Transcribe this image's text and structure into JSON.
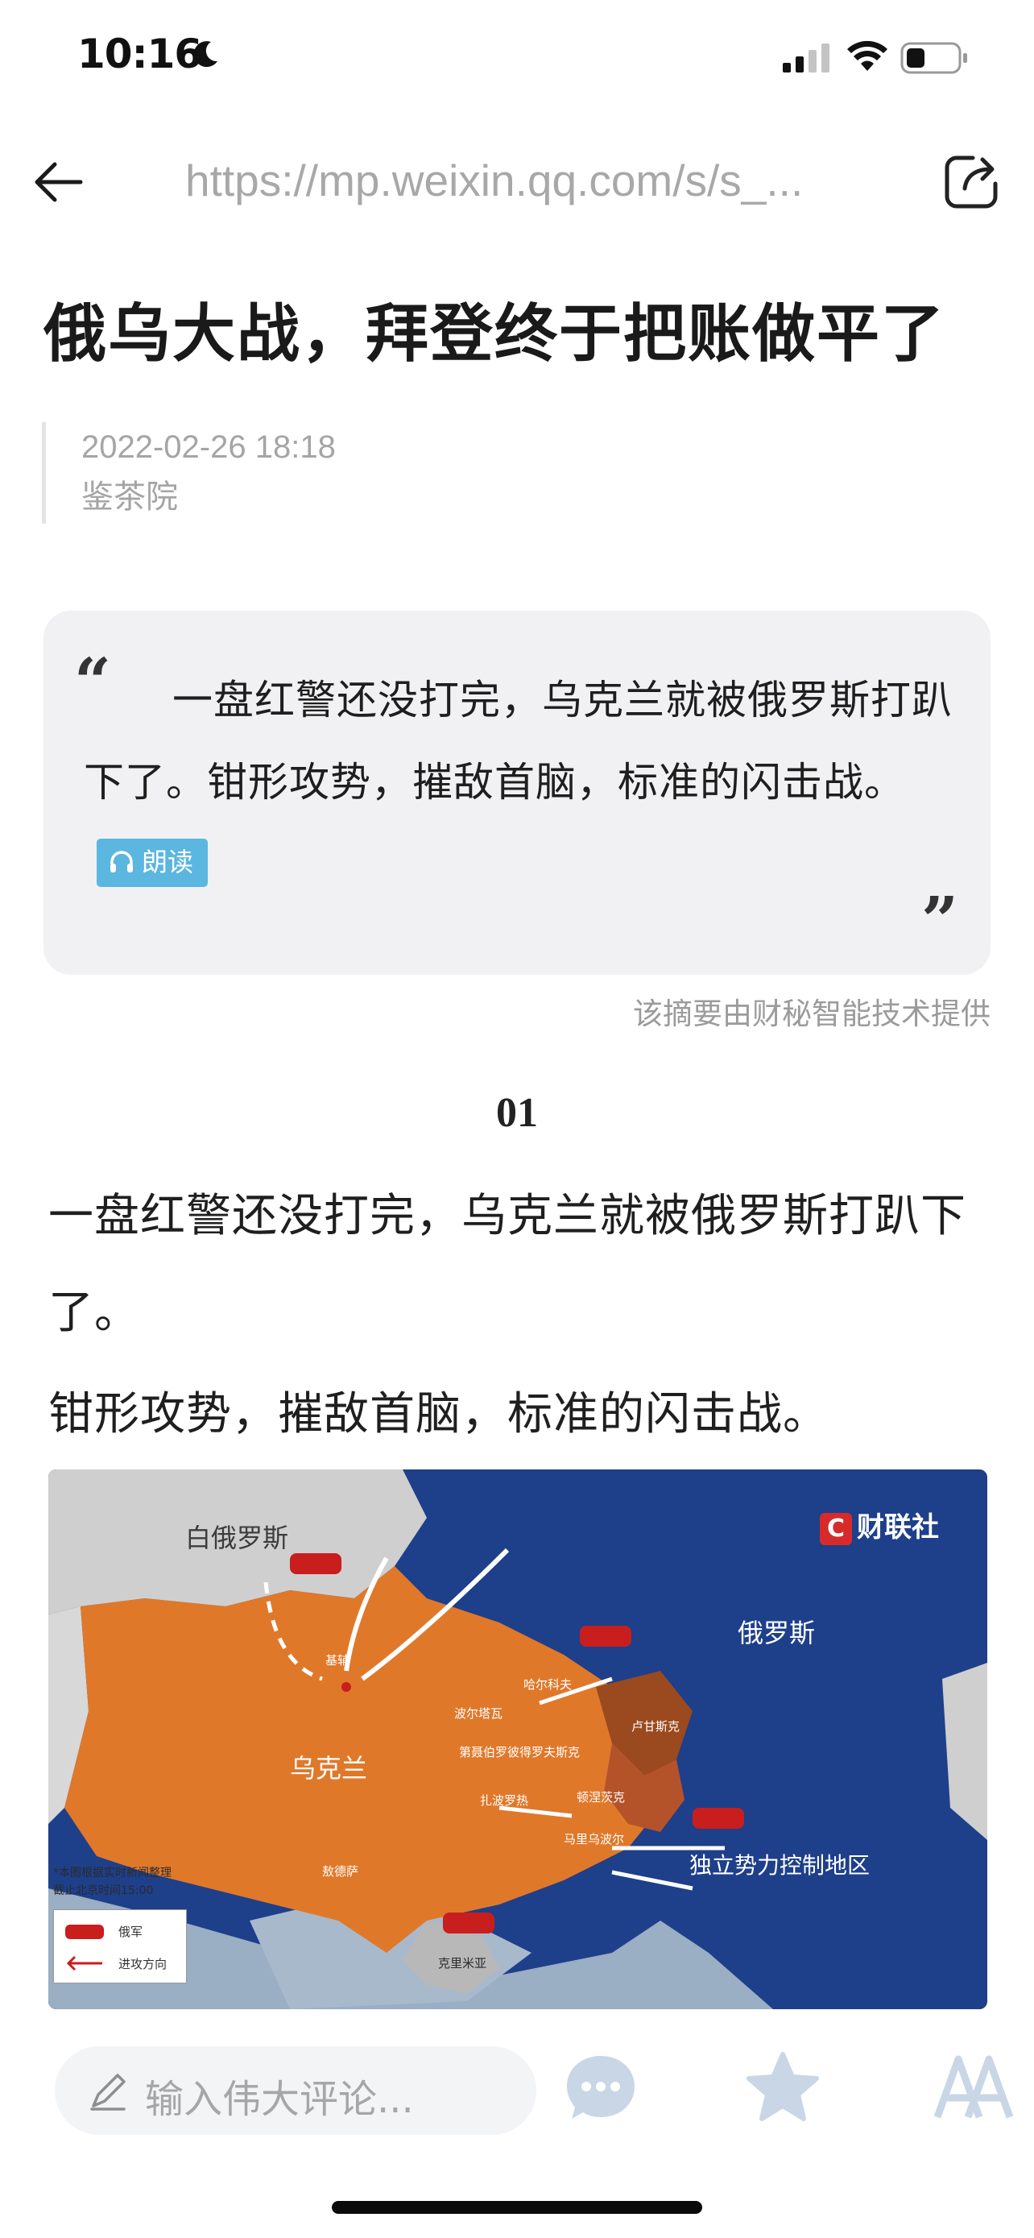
{
  "status_bar": {
    "time": "10:16"
  },
  "nav": {
    "url": "https://mp.weixin.qq.com/s/s_..."
  },
  "article": {
    "title": "俄乌大战，拜登终于把账做平了",
    "date": "2022-02-26 18:18",
    "author": "鉴茶院"
  },
  "summary": {
    "text": "一盘红警还没打完，乌克兰就被俄罗斯打趴下了。钳形攻势，摧敌首脑，标准的闪击战。",
    "read_label": "朗读",
    "credit": "该摘要由财秘智能技术提供",
    "quote_open": "“",
    "quote_close": "”"
  },
  "body": {
    "section_number": "01",
    "paragraph_1": "一盘红警还没打完，乌克兰就被俄罗斯打趴下了。",
    "paragraph_2": "钳形攻势，摧敌首脑，标准的闪击战。"
  },
  "map": {
    "brand": "财联社",
    "brand_mark": "C",
    "labels": {
      "belarus": "白俄罗斯",
      "russia": "俄罗斯",
      "ukraine": "乌克兰",
      "kyiv": "基辅",
      "separatist": "独立势力控制地区",
      "city_1": "哈尔科夫",
      "city_2": "波尔塔瓦",
      "city_3": "第聂伯罗彼得罗夫斯克",
      "city_4": "扎波罗热",
      "city_5": "顿涅茨克",
      "city_6": "卢甘斯克",
      "city_7": "马里乌波尔",
      "city_8": "敖德萨",
      "crimea": "克里米亚"
    },
    "note_line_1": "*本图根据实时新闻整理",
    "note_line_2": "截止北京时间15:00",
    "legend_army": "俄军",
    "legend_direction": "进攻方向",
    "colors": {
      "russia": "#1e3f8a",
      "ukraine": "#e0782a",
      "belarus": "#cfcfcf",
      "separatist": "#9a4a1e"
    }
  },
  "bottom_bar": {
    "comment_placeholder": "输入伟大评论..."
  }
}
